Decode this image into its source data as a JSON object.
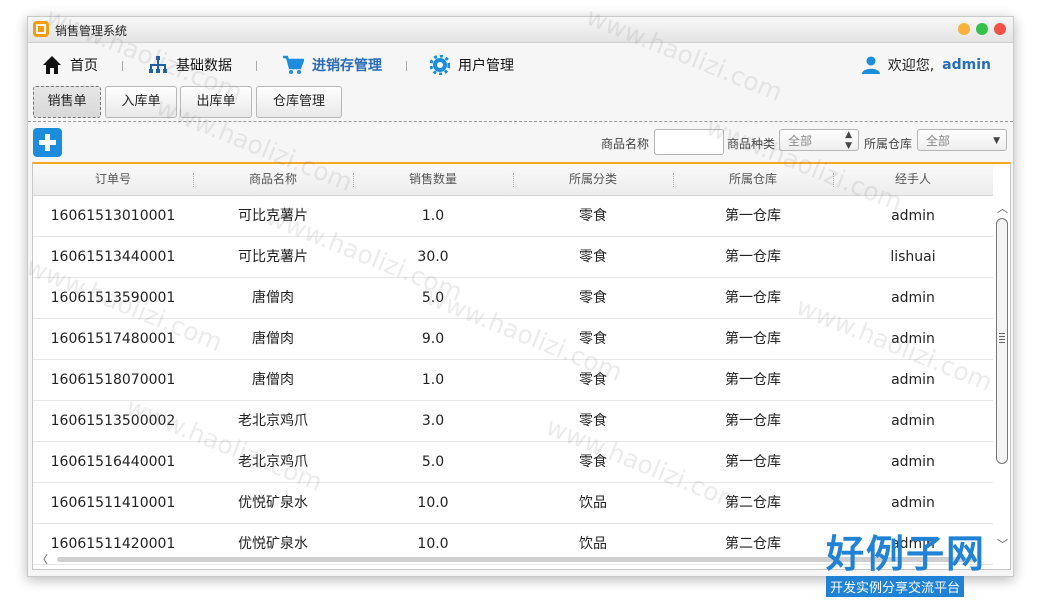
{
  "window": {
    "title": "销售管理系统"
  },
  "menu": {
    "home": "首页",
    "basic_data": "基础数据",
    "inventory": "进销存管理",
    "user_mgmt": "用户管理",
    "welcome": "欢迎您,",
    "username": "admin"
  },
  "tabs": [
    "销售单",
    "入库单",
    "出库单",
    "仓库管理"
  ],
  "filters": {
    "product_name_label": "商品名称",
    "product_name_value": "",
    "category_label": "商品种类",
    "category_value": "全部",
    "warehouse_label": "所属仓库",
    "warehouse_value": "全部"
  },
  "table": {
    "columns": [
      "订单号",
      "商品名称",
      "销售数量",
      "所属分类",
      "所属仓库",
      "经手人"
    ],
    "rows": [
      [
        "16061513010001",
        "可比克薯片",
        "1.0",
        "零食",
        "第一仓库",
        "admin"
      ],
      [
        "16061513440001",
        "可比克薯片",
        "30.0",
        "零食",
        "第一仓库",
        "lishuai"
      ],
      [
        "16061513590001",
        "唐僧肉",
        "5.0",
        "零食",
        "第一仓库",
        "admin"
      ],
      [
        "16061517480001",
        "唐僧肉",
        "9.0",
        "零食",
        "第一仓库",
        "admin"
      ],
      [
        "16061518070001",
        "唐僧肉",
        "1.0",
        "零食",
        "第一仓库",
        "admin"
      ],
      [
        "16061513500002",
        "老北京鸡爪",
        "3.0",
        "零食",
        "第一仓库",
        "admin"
      ],
      [
        "16061516440001",
        "老北京鸡爪",
        "5.0",
        "零食",
        "第一仓库",
        "admin"
      ],
      [
        "16061511410001",
        "优悦矿泉水",
        "10.0",
        "饮品",
        "第二仓库",
        "admin"
      ],
      [
        "16061511420001",
        "优悦矿泉水",
        "10.0",
        "饮品",
        "第二仓库",
        "admin"
      ]
    ]
  },
  "watermark": "www.haolizi.com",
  "brand": {
    "main": "好例子网",
    "sub": "开发实例分享交流平台"
  },
  "colors": {
    "accent": "#2a6cb6",
    "add_button": "#1c8ddc",
    "table_top_border": "#f5a623"
  }
}
